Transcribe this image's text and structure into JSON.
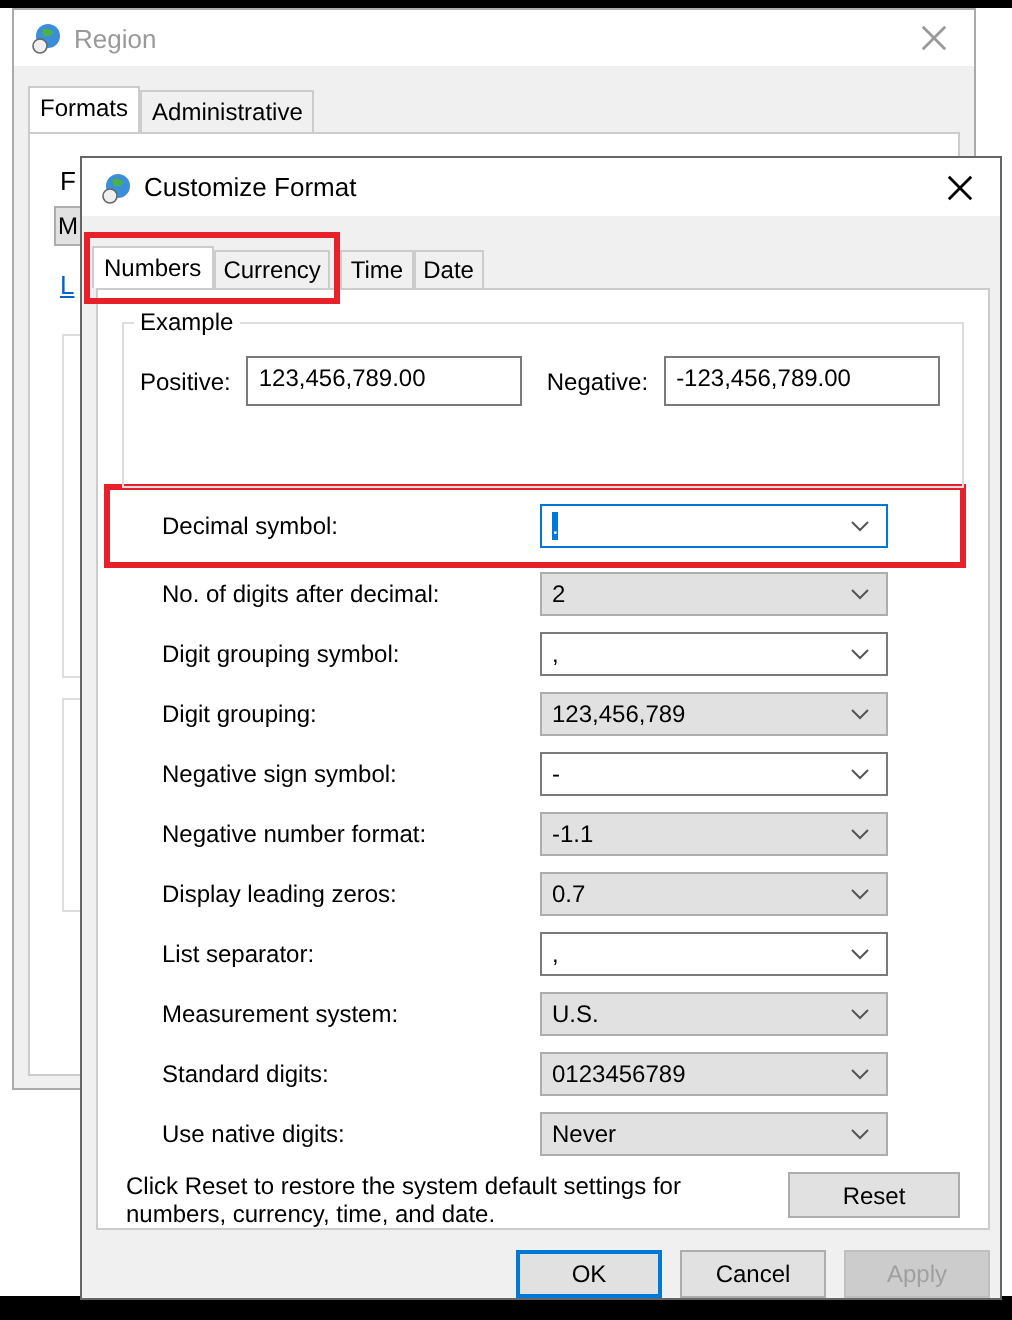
{
  "background_window": {
    "title": "Region",
    "tabs": [
      {
        "label": "Formats",
        "selected": true
      },
      {
        "label": "Administrative",
        "selected": false
      }
    ],
    "partial_label": "F",
    "partial_value": "M",
    "partial_link": "L"
  },
  "dialog": {
    "title": "Customize Format",
    "tabs": [
      {
        "label": "Numbers",
        "selected": true,
        "highlighted": true
      },
      {
        "label": "Currency",
        "selected": false,
        "highlighted": true
      },
      {
        "label": "Time",
        "selected": false,
        "highlighted": false
      },
      {
        "label": "Date",
        "selected": false,
        "highlighted": false
      }
    ],
    "example": {
      "title": "Example",
      "positive_label": "Positive:",
      "positive_value": "123,456,789.00",
      "negative_label": "Negative:",
      "negative_value": "-123,456,789.00"
    },
    "settings": [
      {
        "label": "Decimal symbol:",
        "value": ".",
        "kind": "editable",
        "focused": true,
        "highlighted": true
      },
      {
        "label": "No. of digits after decimal:",
        "value": "2",
        "kind": "dropdown",
        "focused": false,
        "highlighted": false
      },
      {
        "label": "Digit grouping symbol:",
        "value": ",",
        "kind": "editable",
        "focused": false,
        "highlighted": false
      },
      {
        "label": "Digit grouping:",
        "value": "123,456,789",
        "kind": "dropdown",
        "focused": false,
        "highlighted": false
      },
      {
        "label": "Negative sign symbol:",
        "value": "-",
        "kind": "editable",
        "focused": false,
        "highlighted": false
      },
      {
        "label": "Negative number format:",
        "value": "-1.1",
        "kind": "dropdown",
        "focused": false,
        "highlighted": false
      },
      {
        "label": "Display leading zeros:",
        "value": "0.7",
        "kind": "dropdown",
        "focused": false,
        "highlighted": false
      },
      {
        "label": "List separator:",
        "value": ",",
        "kind": "editable",
        "focused": false,
        "highlighted": false
      },
      {
        "label": "Measurement system:",
        "value": "U.S.",
        "kind": "dropdown",
        "focused": false,
        "highlighted": false
      },
      {
        "label": "Standard digits:",
        "value": "0123456789",
        "kind": "dropdown",
        "focused": false,
        "highlighted": false
      },
      {
        "label": "Use native digits:",
        "value": "Never",
        "kind": "dropdown",
        "focused": false,
        "highlighted": false
      }
    ],
    "reset_note": "Click Reset to restore the system default settings for numbers, currency, time, and date.",
    "reset_button": "Reset",
    "buttons": [
      {
        "label": "OK",
        "default": true,
        "disabled": false
      },
      {
        "label": "Cancel",
        "default": false,
        "disabled": false
      },
      {
        "label": "Apply",
        "default": false,
        "disabled": true
      }
    ]
  }
}
